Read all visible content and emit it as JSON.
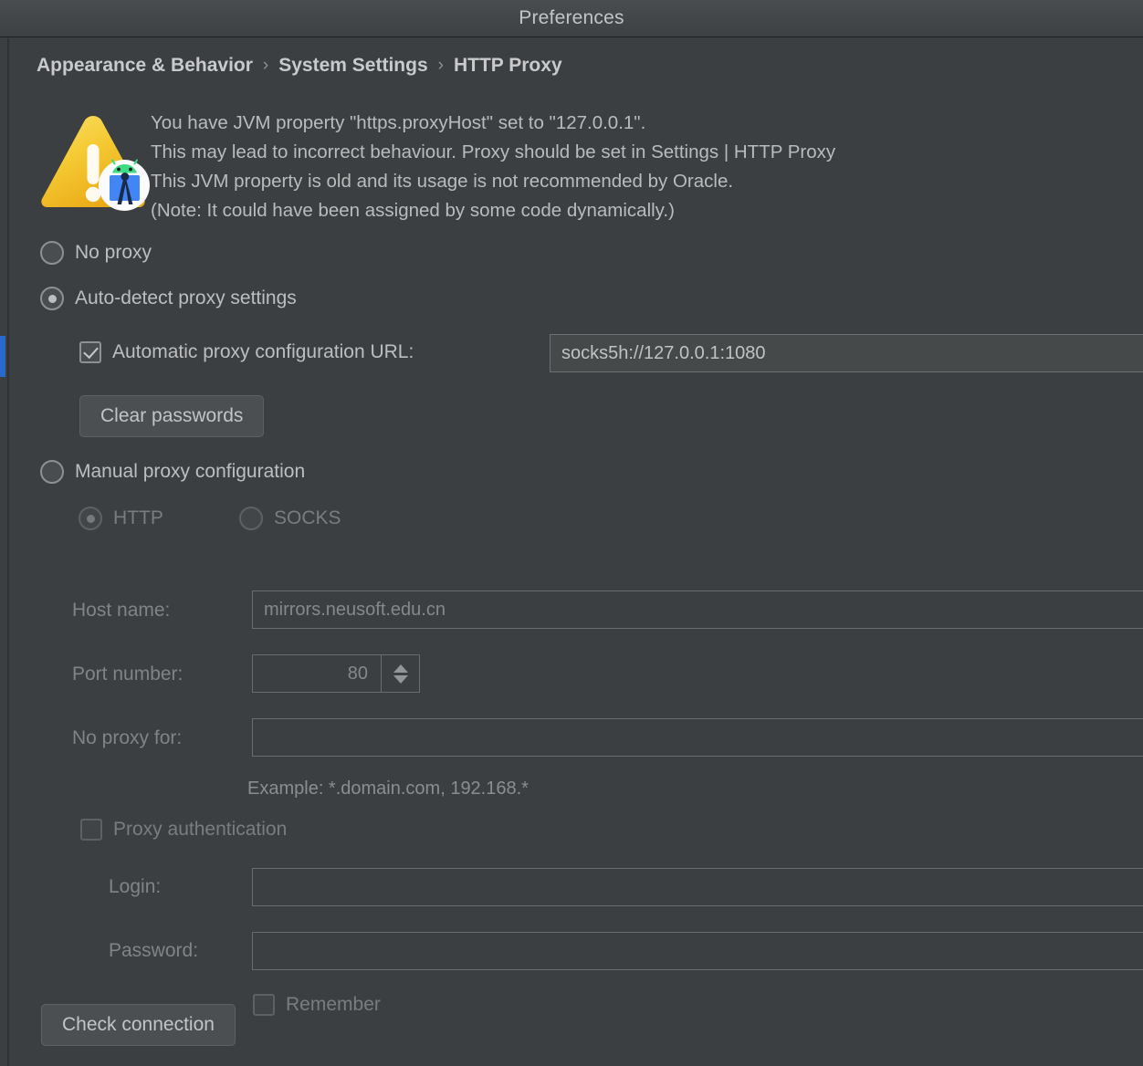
{
  "window": {
    "title": "Preferences"
  },
  "breadcrumb": {
    "items": [
      "Appearance & Behavior",
      "System Settings",
      "HTTP Proxy"
    ],
    "separator": "›"
  },
  "warning": {
    "icon": "warning-triangle-icon",
    "badge_icon": "android-studio-icon",
    "lines": [
      "You have JVM property \"https.proxyHost\" set to \"127.0.0.1\".",
      "This may lead to incorrect behaviour. Proxy should be set in Settings | HTTP Proxy",
      "This JVM property is old and its usage is not recommended by Oracle.",
      "(Note: It could have been assigned by some code dynamically.)"
    ]
  },
  "proxy": {
    "no_proxy_label": "No proxy",
    "no_proxy_selected": false,
    "auto_detect_label": "Auto-detect proxy settings",
    "auto_detect_selected": true,
    "pac_checkbox_label": "Automatic proxy configuration URL:",
    "pac_checked": true,
    "pac_url_value": "socks5h://127.0.0.1:1080",
    "pac_url_placeholder": "",
    "clear_passwords_label": "Clear passwords",
    "manual_label": "Manual proxy configuration",
    "manual_selected": false,
    "http_label": "HTTP",
    "http_selected": true,
    "socks_label": "SOCKS",
    "socks_selected": false,
    "host_name_label": "Host name:",
    "host_name_value": "mirrors.neusoft.edu.cn",
    "port_number_label": "Port number:",
    "port_number_value": "80",
    "no_proxy_for_label": "No proxy for:",
    "no_proxy_for_value": "",
    "example_text": "Example: *.domain.com, 192.168.*",
    "proxy_auth_label": "Proxy authentication",
    "proxy_auth_checked": false,
    "login_label": "Login:",
    "login_value": "",
    "password_label": "Password:",
    "password_value": "",
    "remember_label": "Remember",
    "remember_checked": false,
    "check_connection_label": "Check connection"
  },
  "colors": {
    "background": "#3c3f41",
    "accent_blue": "#2a69cc",
    "warning_yellow": "#f0c020",
    "text": "#bcbec0",
    "text_disabled": "#808487"
  }
}
